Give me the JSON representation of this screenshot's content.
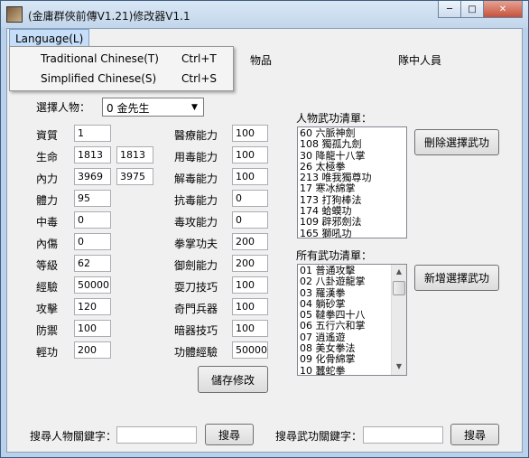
{
  "window": {
    "title": "(金庸群俠前傳V1.21)修改器V1.1",
    "min_glyph": "─",
    "max_glyph": "□",
    "close_glyph": "✕"
  },
  "menu": {
    "language": "Language(L)",
    "items": [
      {
        "label": "Traditional Chinese(T)",
        "shortcut": "Ctrl+T"
      },
      {
        "label": "Simplified Chinese(S)",
        "shortcut": "Ctrl+S"
      }
    ]
  },
  "tabs": [
    "物品",
    "隊中人員"
  ],
  "select_person": {
    "label": "選擇人物：",
    "value": "0 金先生"
  },
  "attrs_left": [
    {
      "label": "資質",
      "v1": "1",
      "v2": null
    },
    {
      "label": "生命",
      "v1": "1813",
      "v2": "1813"
    },
    {
      "label": "內力",
      "v1": "3969",
      "v2": "3975"
    },
    {
      "label": "體力",
      "v1": "95",
      "v2": null
    },
    {
      "label": "中毒",
      "v1": "0",
      "v2": null
    },
    {
      "label": "內傷",
      "v1": "0",
      "v2": null
    },
    {
      "label": "等級",
      "v1": "62",
      "v2": null
    },
    {
      "label": "經驗",
      "v1": "50000",
      "v2": null
    },
    {
      "label": "攻擊",
      "v1": "120",
      "v2": null
    },
    {
      "label": "防禦",
      "v1": "100",
      "v2": null
    },
    {
      "label": "輕功",
      "v1": "200",
      "v2": null
    }
  ],
  "attrs_right": [
    {
      "label": "醫療能力",
      "v": "100"
    },
    {
      "label": "用毒能力",
      "v": "100"
    },
    {
      "label": "解毒能力",
      "v": "100"
    },
    {
      "label": "抗毒能力",
      "v": "0"
    },
    {
      "label": "毒攻能力",
      "v": "0"
    },
    {
      "label": "拳掌功夫",
      "v": "200"
    },
    {
      "label": "御劍能力",
      "v": "200"
    },
    {
      "label": "耍刀技巧",
      "v": "100"
    },
    {
      "label": "奇門兵器",
      "v": "100"
    },
    {
      "label": "暗器技巧",
      "v": "100"
    },
    {
      "label": "功體經驗",
      "v": "50000"
    }
  ],
  "person_skills": {
    "label": "人物武功清單：",
    "items": [
      "60 六脈神劍",
      "108 獨孤九劍",
      "30 降龍十八掌",
      "26 太極拳",
      "213 唯我獨尊功",
      "17 寒冰綿掌",
      "173 打狗棒法",
      "174 蛤蟆功",
      "109 辟邪劍法",
      "165 獅吼功"
    ]
  },
  "all_skills": {
    "label": "所有武功清單：",
    "items": [
      "01 普通攻擊",
      "02 八卦遊龍掌",
      "03 羅漢拳",
      "04 躺砂掌",
      "05 韃拳四十八",
      "06 五行六和掌",
      "07 逍遙遊",
      "08 美女拳法",
      "09 化骨綿掌",
      "10 蠶蛇拳"
    ]
  },
  "buttons": {
    "delete_skill": "刪除選擇武功",
    "add_skill": "新增選擇武功",
    "save": "儲存修改",
    "search_person": "搜尋",
    "search_skill": "搜尋"
  },
  "search": {
    "person_label": "搜尋人物關鍵字：",
    "person_value": "",
    "skill_label": "搜尋武功關鍵字：",
    "skill_value": ""
  }
}
